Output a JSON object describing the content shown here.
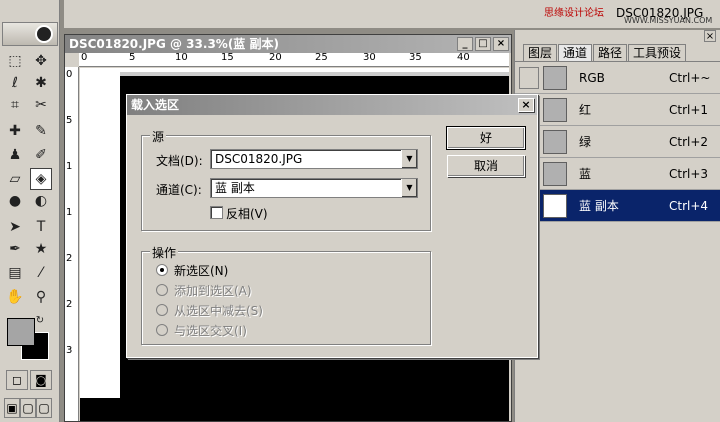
{
  "topbar": {
    "file_name": "DSC01820.JPG",
    "watermark": "思缘设计论坛",
    "watermark2": "WWW.MISSYUAN.COM"
  },
  "document": {
    "title": "DSC01820.JPG @ 33.3%(蓝 副本)",
    "minimize": "_",
    "maximize": "□",
    "close": "×",
    "ruler_top": [
      "0",
      "5",
      "10",
      "15",
      "20",
      "25",
      "30",
      "35",
      "40"
    ],
    "ruler_left": [
      "0",
      "5",
      "1",
      "1",
      "2",
      "2",
      "3"
    ]
  },
  "panel": {
    "close": "×",
    "tabs": [
      "图层",
      "通道",
      "路径",
      "工具预设"
    ],
    "active_tab": 1,
    "channels": [
      {
        "name": "RGB",
        "shortcut": "Ctrl+~",
        "selected": false
      },
      {
        "name": "红",
        "shortcut": "Ctrl+1",
        "selected": false
      },
      {
        "name": "绿",
        "shortcut": "Ctrl+2",
        "selected": false
      },
      {
        "name": "蓝",
        "shortcut": "Ctrl+3",
        "selected": false
      },
      {
        "name": "蓝 副本",
        "shortcut": "Ctrl+4",
        "selected": true
      }
    ]
  },
  "dialog": {
    "title": "载入选区",
    "close": "×",
    "source_group": "源",
    "doc_label": "文档(D):",
    "doc_value": "DSC01820.JPG",
    "channel_label": "通道(C):",
    "channel_value": "蓝 副本",
    "invert_label": "反相(V)",
    "op_group": "操作",
    "ops": [
      {
        "label": "新选区(N)",
        "checked": true,
        "disabled": false
      },
      {
        "label": "添加到选区(A)",
        "checked": false,
        "disabled": true
      },
      {
        "label": "从选区中减去(S)",
        "checked": false,
        "disabled": true
      },
      {
        "label": "与选区交叉(I)",
        "checked": false,
        "disabled": true
      }
    ],
    "ok": "好",
    "cancel": "取消"
  }
}
